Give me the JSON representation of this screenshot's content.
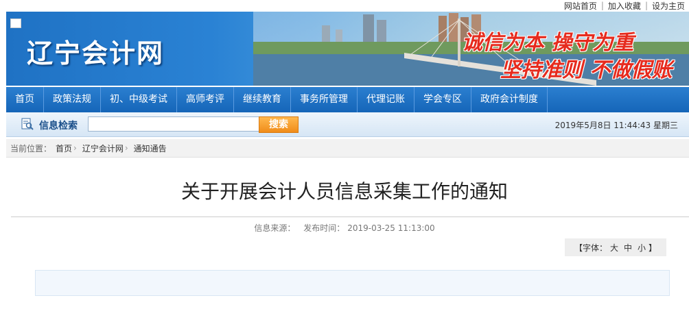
{
  "top_links": [
    "网站首页",
    "加入收藏",
    "设为主页"
  ],
  "site_title": "辽宁会计网",
  "slogans": [
    "诚信为本 操守为重",
    "坚持准则 不做假账"
  ],
  "nav": [
    "首页",
    "政策法规",
    "初、中级考试",
    "高师考评",
    "继续教育",
    "事务所管理",
    "代理记账",
    "学会专区",
    "政府会计制度"
  ],
  "search": {
    "label": "信息检索",
    "button": "搜索",
    "value": ""
  },
  "datetime": "2019年5月8日 11:44:43 星期三",
  "breadcrumb": {
    "prefix": "当前位置：",
    "items": [
      "首页",
      "辽宁会计网",
      "通知通告"
    ]
  },
  "article": {
    "title": "关于开展会计人员信息采集工作的通知",
    "source_label": "信息来源：",
    "publish_label": "发布时间：",
    "publish_time": "2019-03-25 11:13:00"
  },
  "fontsize": {
    "prefix": "【字体：",
    "large": "大",
    "medium": "中",
    "small": "小",
    "suffix": "】"
  },
  "colors": {
    "nav_bg": "#1f6fc2",
    "banner_bg": "#2a82d4",
    "search_btn": "#f08c1a",
    "slogan": "#e62b1e"
  }
}
